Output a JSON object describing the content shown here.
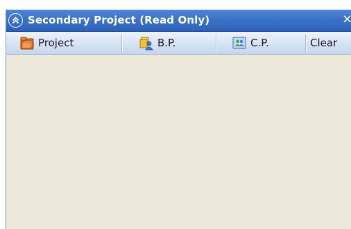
{
  "window": {
    "title": "Secondary Project (Read Only)",
    "collapse_icon": "double-chevron-up-icon",
    "close_icon": "close-icon",
    "close_glyph": "×"
  },
  "toolbar": {
    "buttons": [
      {
        "label": "Project",
        "icon": "project-folder-icon"
      },
      {
        "label": "B.P.",
        "icon": "business-partner-icon"
      },
      {
        "label": "C.P.",
        "icon": "contact-person-icon"
      },
      {
        "label": "Clear",
        "icon": "clear-icon"
      }
    ]
  },
  "colors": {
    "titlebar": "#3a72c8",
    "toolbar": "#d9e4f5",
    "content": "#ebe8da"
  }
}
